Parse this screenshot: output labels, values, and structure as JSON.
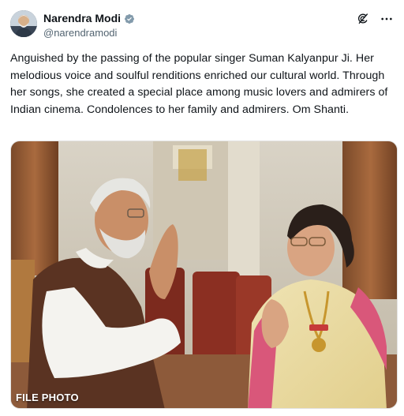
{
  "author": {
    "display_name": "Narendra Modi",
    "handle": "@narendramodi",
    "verified": true,
    "verified_color": "#829aab"
  },
  "actions": {
    "grok_icon": "grok-icon",
    "more_icon": "more-horizontal-icon"
  },
  "tweet": {
    "text": "Anguished by the passing of the popular singer Suman Kalyanpur Ji. Her melodious voice and soulful renditions enriched our cultural world. Through her songs, she created a special place among music lovers and admirers of Indian cinema. Condolences to her family and admirers. Om Shanti."
  },
  "media": {
    "overlay_label": "FILE PHOTO"
  }
}
